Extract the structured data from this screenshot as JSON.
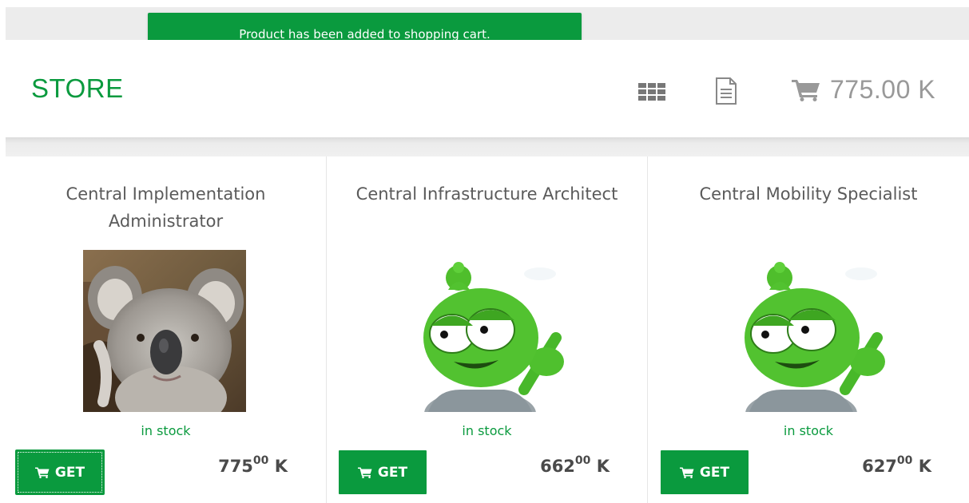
{
  "notification": {
    "text": "Product has been added to shopping cart."
  },
  "header": {
    "title": "STORE",
    "grid_icon": "grid-view-icon",
    "doc_icon": "document-icon",
    "cart_icon": "shopping-cart-icon",
    "cart_total": "775.00 K"
  },
  "colors": {
    "accent": "#0a9a3e",
    "muted": "#999999"
  },
  "products": [
    {
      "title": "Central Implementation Administrator",
      "image": "koala-photo",
      "stock": "in stock",
      "button": "GET",
      "price_main": "775",
      "price_cents": "00",
      "price_unit": "K"
    },
    {
      "title": "Central Infrastructure Architect",
      "image": "green-alien-mascot",
      "stock": "in stock",
      "button": "GET",
      "price_main": "662",
      "price_cents": "00",
      "price_unit": "K"
    },
    {
      "title": "Central Mobility Specialist",
      "image": "green-alien-mascot",
      "stock": "in stock",
      "button": "GET",
      "price_main": "627",
      "price_cents": "00",
      "price_unit": "K"
    }
  ]
}
